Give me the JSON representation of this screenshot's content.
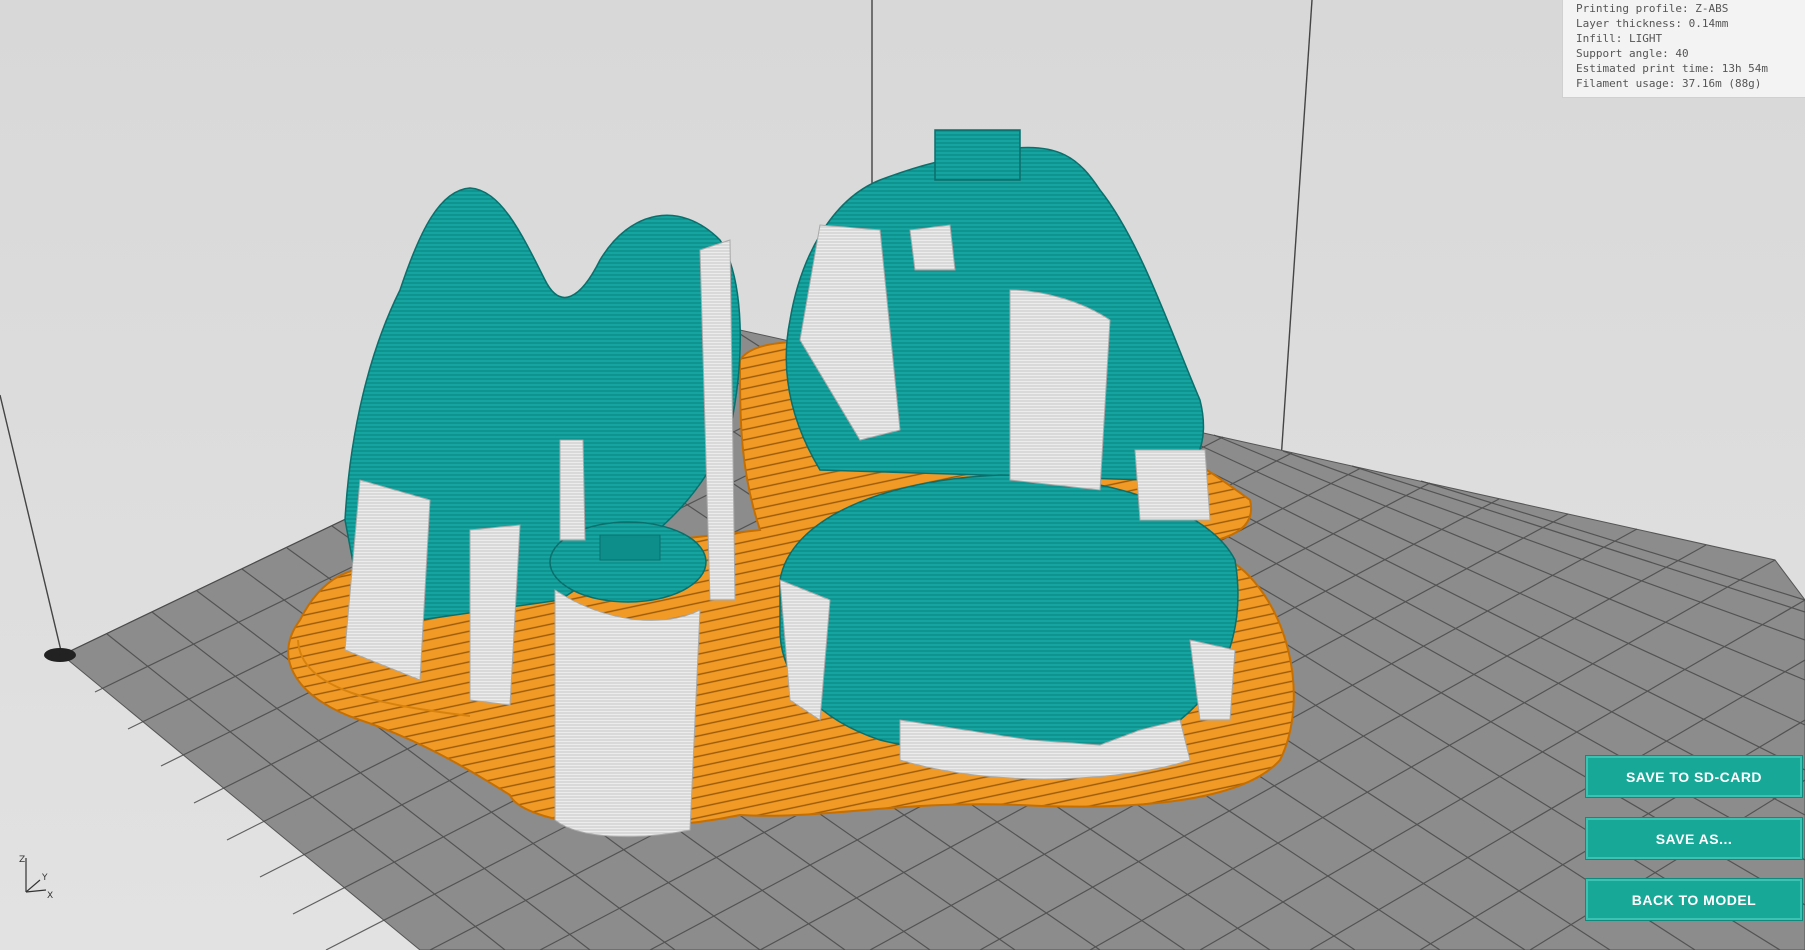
{
  "info": {
    "profile": "Printing profile: Z-ABS",
    "layer": "Layer thickness: 0.14mm",
    "infill": "Infill: LIGHT",
    "support": "Support angle: 40",
    "time": "Estimated print time: 13h 54m",
    "filament": "Filament usage: 37.16m (88g)"
  },
  "actions": {
    "save_sd": "SAVE TO SD-CARD",
    "save_as": "SAVE AS...",
    "back": "BACK TO MODEL"
  },
  "axes": {
    "z": "Z",
    "y": "Y",
    "x": "X"
  },
  "colors": {
    "model": "#119e9a",
    "support": "#e8e8e8",
    "raft": "#f0931c",
    "bed": "#8a8a8a",
    "button": "#17a898"
  }
}
